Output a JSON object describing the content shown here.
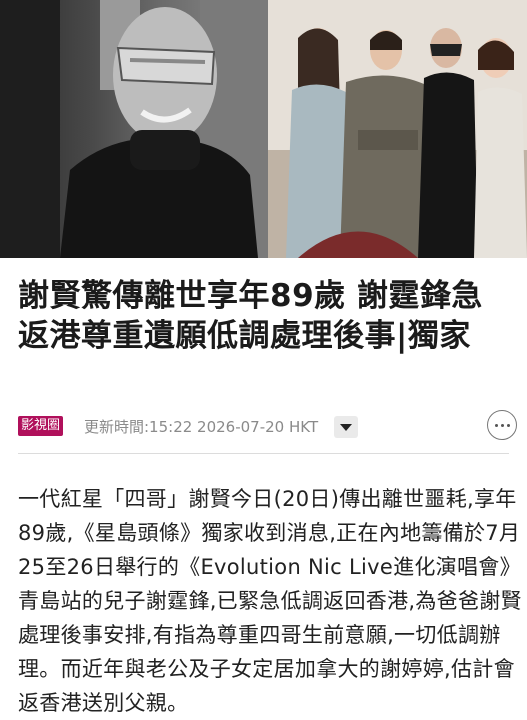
{
  "article": {
    "headline": "謝賢驚傳離世享年89歲 謝霆鋒急返港尊重遺願低調處理後事|獨家",
    "category_tag": "影視圈",
    "updated_label": "更新時間:15:22 2026-07-20 HKT",
    "body": "一代紅星「四哥」謝賢今日(20日)傳出離世噩耗,享年89歲,《星島頭條》獨家收到消息,正在內地籌備於7月25至26日舉行的《Evolution Nic Live進化演唱會》青島站的兒子謝霆鋒,已緊急低調返回香港,為爸爸謝賢處理後事安排,有指為尊重四哥生前意願,一切低調辦理。而近年與老公及子女定居加拿大的謝婷婷,估計會返香港送別父親。"
  },
  "colors": {
    "tag_bg": "#b0105b",
    "headline": "#1b1b1b",
    "meta_text": "#8a8a8a"
  },
  "icons": {
    "dropdown": "caret-down-icon",
    "more": "more-options-icon"
  }
}
